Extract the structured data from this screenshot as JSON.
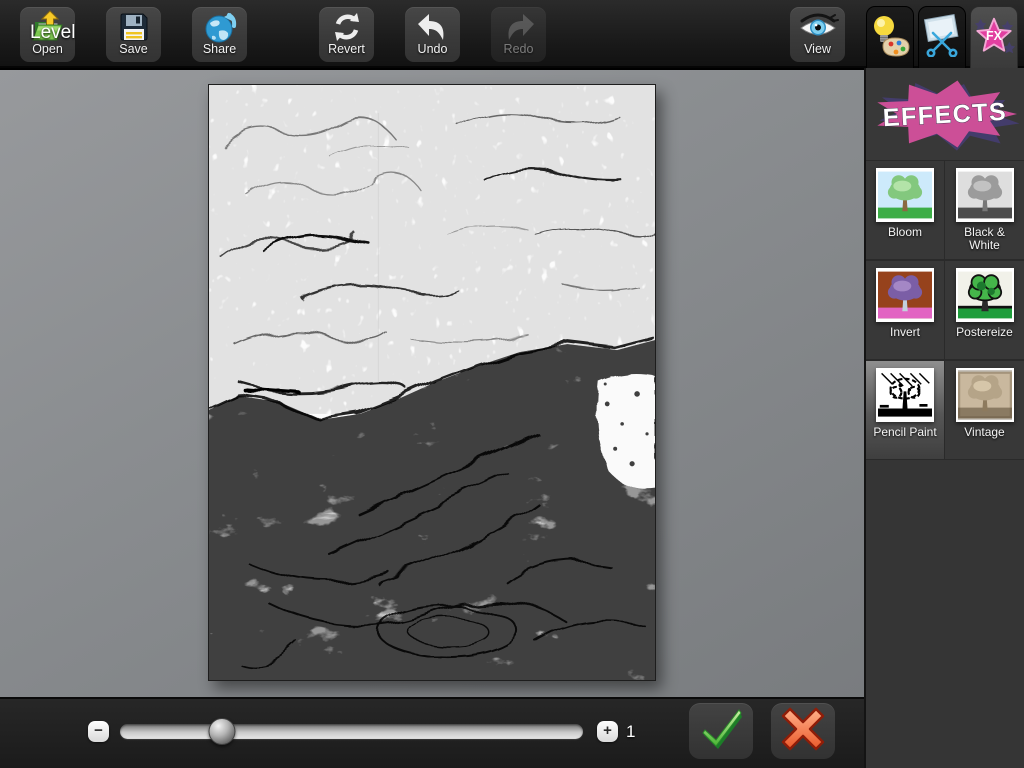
{
  "toolbar": {
    "buttons": [
      {
        "id": "open",
        "label": "Open"
      },
      {
        "id": "save",
        "label": "Save"
      },
      {
        "id": "share",
        "label": "Share"
      },
      {
        "id": "revert",
        "label": "Revert"
      },
      {
        "id": "undo",
        "label": "Undo"
      },
      {
        "id": "redo",
        "label": "Redo",
        "disabled": true
      },
      {
        "id": "view",
        "label": "View"
      }
    ]
  },
  "sidebar": {
    "tabs": [
      {
        "id": "paint-tools",
        "icon": "palette-bulb-icon",
        "selected": false
      },
      {
        "id": "crop-tools",
        "icon": "crop-scissors-icon",
        "selected": false
      },
      {
        "id": "effects",
        "icon": "fx-star-icon",
        "label": "FX",
        "selected": true
      }
    ],
    "panel_title": "EFFECTS",
    "effects": [
      {
        "label": "Bloom",
        "selected": false
      },
      {
        "label": "Black & White",
        "selected": false
      },
      {
        "label": "Invert",
        "selected": false
      },
      {
        "label": "Postereize",
        "selected": false
      },
      {
        "label": "Pencil Paint",
        "selected": true
      },
      {
        "label": "Vintage",
        "selected": false
      }
    ]
  },
  "bottom_bar": {
    "label": "Level",
    "minus": "−",
    "plus": "+",
    "value": "1",
    "slider_percent": 22
  },
  "colors": {
    "effects_accent_pink": "#cc4f97",
    "apply_green": "#3fae3c",
    "cancel_red": "#e8582c"
  }
}
